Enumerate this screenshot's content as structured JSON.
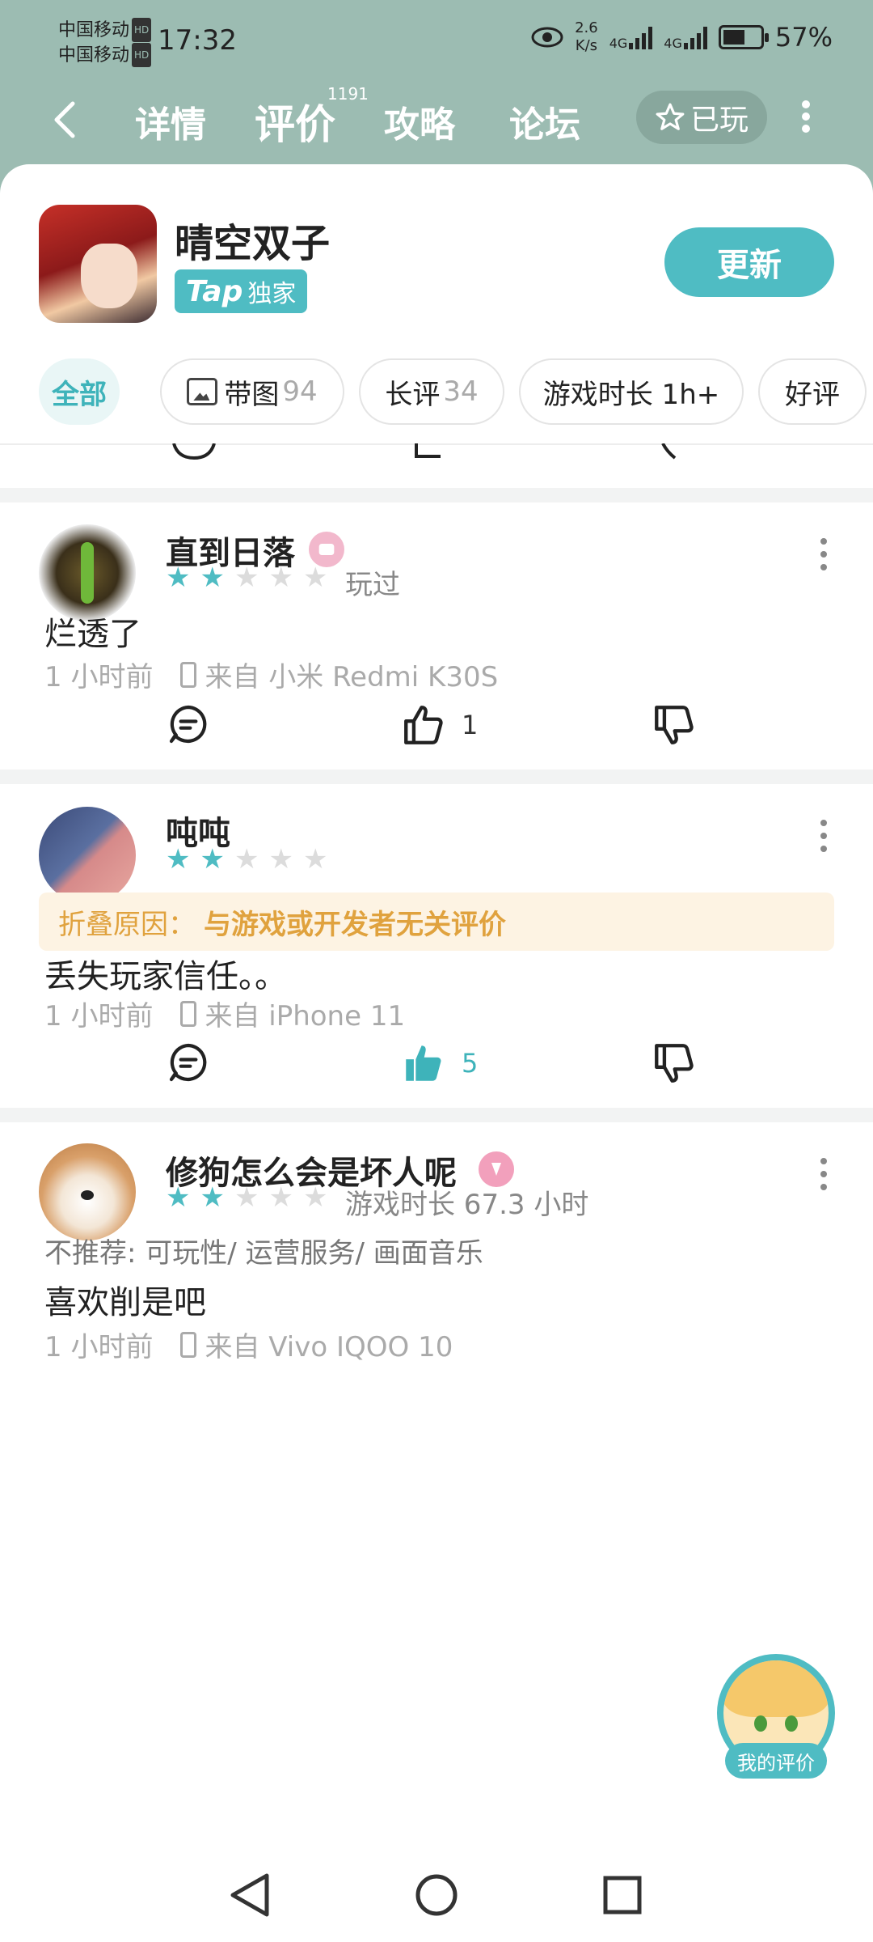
{
  "status_bar": {
    "carrier1": "中国移动",
    "carrier2": "中国移动",
    "hd": "HD",
    "time": "17:32",
    "speed_value": "2.6",
    "speed_unit": "K/s",
    "signal1": "4G",
    "signal2": "4G",
    "battery": "57%"
  },
  "nav": {
    "tabs": [
      "详情",
      "评价",
      "攻略",
      "论坛"
    ],
    "review_count": "1191",
    "played_label": "已玩"
  },
  "app": {
    "name": "晴空双子",
    "badge_tap": "Tap",
    "badge_text": "独家",
    "update_label": "更新"
  },
  "filters": [
    {
      "label": "全部",
      "count": ""
    },
    {
      "label": "带图",
      "count": "94"
    },
    {
      "label": "长评",
      "count": "34"
    },
    {
      "label": "游戏时长 1h+",
      "count": ""
    },
    {
      "label": "好评",
      "count": ""
    }
  ],
  "reviews": [
    {
      "user": "直到日落",
      "rating": 2,
      "status": "玩过",
      "content": "烂透了",
      "time": "1 小时前",
      "device": "来自 小米 Redmi K30S",
      "likes": "1"
    },
    {
      "user": "吨吨",
      "rating": 2,
      "fold_label": "折叠原因：",
      "fold_reason": "与游戏或开发者无关评价",
      "content": "丢失玩家信任。。",
      "time": "1 小时前",
      "device": "来自 iPhone 11",
      "likes": "5"
    },
    {
      "user": "修狗怎么会是坏人呢",
      "rating": 2,
      "playtime": "游戏时长 67.3 小时",
      "tags": "不推荐: 可玩性/ 运营服务/ 画面音乐",
      "content": "喜欢削是吧",
      "time": "1 小时前",
      "device": "来自 Vivo IQOO 10"
    }
  ],
  "fab": {
    "label": "我的评价"
  },
  "colors": {
    "accent": "#4fbcc3",
    "header_bg": "#9cbcb2",
    "fold_text": "#e0a23e"
  }
}
